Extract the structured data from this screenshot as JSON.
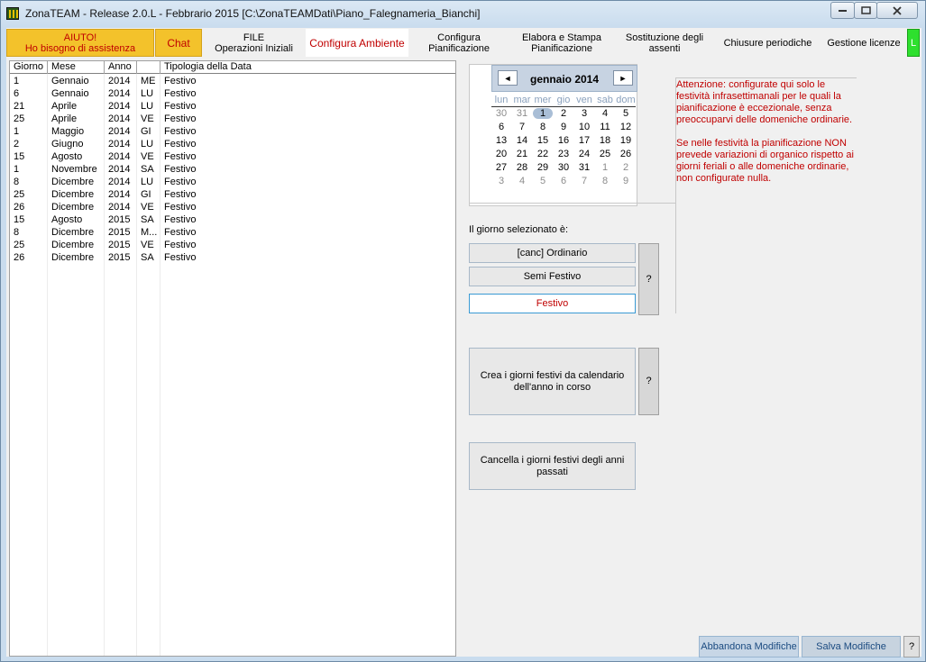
{
  "window": {
    "title": "ZonaTEAM - Release 2.0.L - Febbrario 2015 [C:\\ZonaTEAMDati\\Piano_Falegnameria_Bianchi]"
  },
  "tabs": [
    {
      "line1": "AIUTO!",
      "line2": "Ho bisogno di assistenza"
    },
    {
      "line1": "Chat",
      "line2": ""
    },
    {
      "line1": "FILE",
      "line2": "Operazioni Iniziali"
    },
    {
      "line1": "Configura Ambiente",
      "line2": ""
    },
    {
      "line1": "Configura",
      "line2": "Pianificazione"
    },
    {
      "line1": "Elabora e Stampa",
      "line2": "Pianificazione"
    },
    {
      "line1": "Sostituzione degli",
      "line2": "assenti"
    },
    {
      "line1": "Chiusure periodiche",
      "line2": ""
    },
    {
      "line1": "Gestione licenze",
      "line2": ""
    },
    {
      "line1": "L",
      "line2": ""
    }
  ],
  "grid": {
    "columns": [
      "Giorno",
      "Mese",
      "Anno",
      "",
      "Tipologia della Data"
    ],
    "rows": [
      [
        "1",
        "Gennaio",
        "2014",
        "ME",
        "Festivo"
      ],
      [
        "6",
        "Gennaio",
        "2014",
        "LU",
        "Festivo"
      ],
      [
        "21",
        "Aprile",
        "2014",
        "LU",
        "Festivo"
      ],
      [
        "25",
        "Aprile",
        "2014",
        "VE",
        "Festivo"
      ],
      [
        "1",
        "Maggio",
        "2014",
        "GI",
        "Festivo"
      ],
      [
        "2",
        "Giugno",
        "2014",
        "LU",
        "Festivo"
      ],
      [
        "15",
        "Agosto",
        "2014",
        "VE",
        "Festivo"
      ],
      [
        "1",
        "Novembre",
        "2014",
        "SA",
        "Festivo"
      ],
      [
        "8",
        "Dicembre",
        "2014",
        "LU",
        "Festivo"
      ],
      [
        "25",
        "Dicembre",
        "2014",
        "GI",
        "Festivo"
      ],
      [
        "26",
        "Dicembre",
        "2014",
        "VE",
        "Festivo"
      ],
      [
        "15",
        "Agosto",
        "2015",
        "SA",
        "Festivo"
      ],
      [
        "8",
        "Dicembre",
        "2015",
        "M...",
        "Festivo"
      ],
      [
        "25",
        "Dicembre",
        "2015",
        "VE",
        "Festivo"
      ],
      [
        "26",
        "Dicembre",
        "2015",
        "SA",
        "Festivo"
      ]
    ]
  },
  "calendar": {
    "title": "gennaio 2014",
    "prev_label": "◄",
    "next_label": "►",
    "dow": [
      "lun",
      "mar",
      "mer",
      "gio",
      "ven",
      "sab",
      "dom"
    ],
    "weeks": [
      [
        "30",
        "31",
        "1",
        "2",
        "3",
        "4",
        "5"
      ],
      [
        "6",
        "7",
        "8",
        "9",
        "10",
        "11",
        "12"
      ],
      [
        "13",
        "14",
        "15",
        "16",
        "17",
        "18",
        "19"
      ],
      [
        "20",
        "21",
        "22",
        "23",
        "24",
        "25",
        "26"
      ],
      [
        "27",
        "28",
        "29",
        "30",
        "31",
        "1",
        "2"
      ],
      [
        "3",
        "4",
        "5",
        "6",
        "7",
        "8",
        "9"
      ]
    ],
    "selected_day": "1"
  },
  "warning": {
    "p1": "Attenzione: configurate qui solo le festività infrasettimanali per le quali la pianificazione è eccezionale, senza preoccuparvi delle domeniche ordinarie.",
    "p2": "Se nelle festività la pianificazione NON prevede variazioni di organico rispetto ai giorni feriali o alle domeniche ordinarie, non configurate nulla."
  },
  "day_type": {
    "label": "Il giorno selezionato è:",
    "ordinario": "[canc] Ordinario",
    "semi_festivo": "Semi Festivo",
    "festivo": "Festivo",
    "help": "?"
  },
  "actions": {
    "crea": "Crea i giorni festivi da calendario dell'anno in corso",
    "crea_help": "?",
    "cancella": "Cancella i giorni festivi degli anni passati"
  },
  "footer": {
    "abbandona": "Abbandona Modifiche",
    "salva": "Salva Modifiche",
    "help": "?"
  },
  "colors": {
    "accent_red": "#c00000",
    "aiuto_bg": "#f3c22b",
    "license_green": "#2ee02e"
  }
}
